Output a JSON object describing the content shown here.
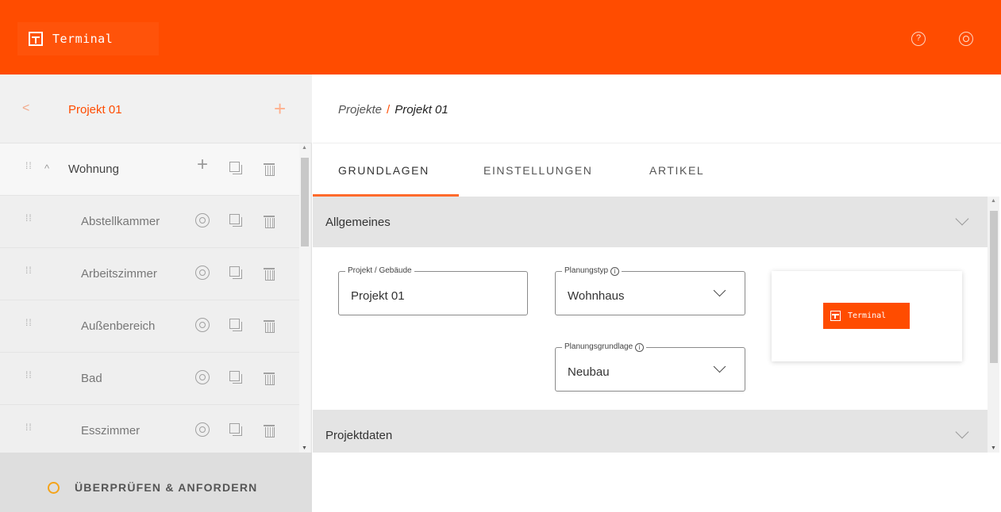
{
  "app": {
    "name": "Terminal",
    "brand_color": "#ff4c00"
  },
  "header": {
    "help_icon": "help-circle-icon",
    "settings_icon": "gear-icon"
  },
  "sidebar": {
    "title": "Projekt 01",
    "back_icon": "chevron-left-icon",
    "add_icon": "plus-icon",
    "parent": {
      "label": "Wohnung"
    },
    "items": [
      {
        "label": "Abstellkammer"
      },
      {
        "label": "Arbeitszimmer"
      },
      {
        "label": "Außenbereich"
      },
      {
        "label": "Bad"
      },
      {
        "label": "Esszimmer"
      }
    ],
    "footer_label": "ÜBERPRÜFEN & ANFORDERN"
  },
  "breadcrumb": {
    "root": "Projekte",
    "separator": "/",
    "current": "Projekt 01"
  },
  "tabs": [
    {
      "label": "GRUNDLAGEN",
      "active": true
    },
    {
      "label": "EINSTELLUNGEN",
      "active": false
    },
    {
      "label": "ARTIKEL",
      "active": false
    }
  ],
  "sections": {
    "general": {
      "title": "Allgemeines",
      "expanded": true
    },
    "project_data": {
      "title": "Projektdaten",
      "expanded": false
    }
  },
  "form": {
    "project": {
      "label": "Projekt / Gebäude",
      "value": "Projekt 01"
    },
    "planning_type": {
      "label": "Planungstyp",
      "value": "Wohnhaus"
    },
    "planning_basis": {
      "label": "Planungsgrundlage",
      "value": "Neubau"
    }
  },
  "preview": {
    "logo_text": "Terminal"
  }
}
